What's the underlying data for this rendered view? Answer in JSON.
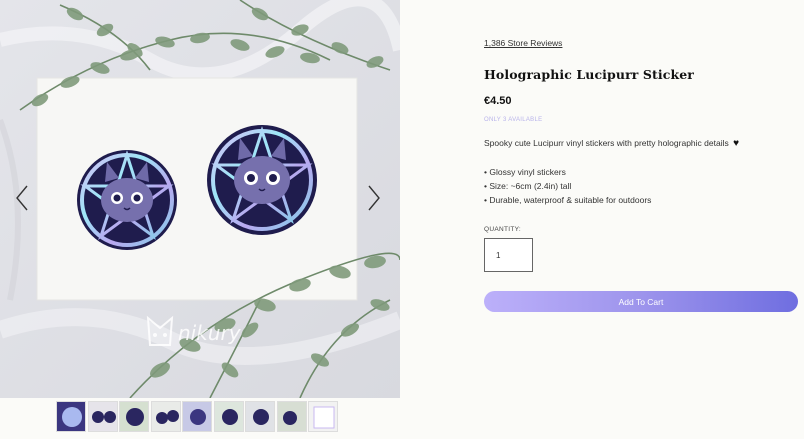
{
  "gallery": {
    "prev_icon": "chevron-left-icon",
    "next_icon": "chevron-right-icon",
    "watermark": "nikury",
    "thumbnail_count": 9
  },
  "product": {
    "reviews_link": "1,386 Store Reviews",
    "title": "Holographic Lucipurr Sticker",
    "price": "€4.50",
    "availability": "ONLY 3 AVAILABLE",
    "description": "Spooky cute Lucipurr vinyl stickers with pretty holographic details",
    "description_icon": "heart-icon",
    "features": [
      "• Glossy vinyl stickers",
      "• Size: ~6cm (2.4in) tall",
      "• Durable, waterproof & suitable for outdoors"
    ],
    "quantity_label": "QUANTITY:",
    "quantity_value": "1",
    "add_to_cart_label": "Add To Cart"
  },
  "colors": {
    "accent_gradient_start": "#bcb0fa",
    "accent_gradient_end": "#6f6ee0",
    "availability_text": "#b8b3ea"
  }
}
